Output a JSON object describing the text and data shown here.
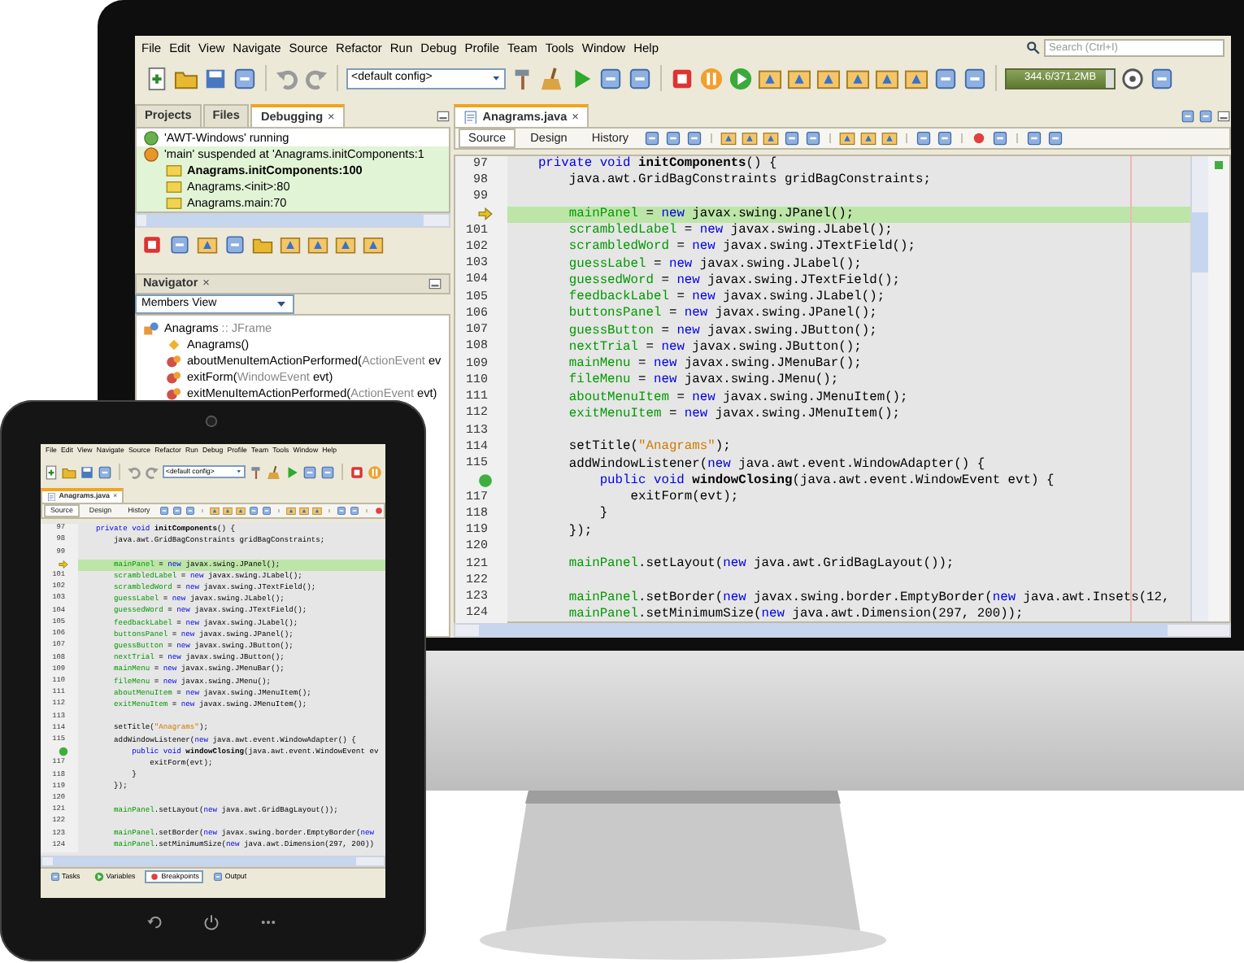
{
  "monitor": {
    "menu": [
      "File",
      "Edit",
      "View",
      "Navigate",
      "Source",
      "Refactor",
      "Run",
      "Debug",
      "Profile",
      "Team",
      "Tools",
      "Window",
      "Help"
    ],
    "search": {
      "placeholder": "Search (Ctrl+I)"
    },
    "config": "<default config>",
    "memory": {
      "reading": "344.6/371.2MB",
      "level": 0.93
    },
    "side_tabs": [
      {
        "label": "Projects",
        "selected": false
      },
      {
        "label": "Files",
        "selected": false
      },
      {
        "label": "Debugging",
        "selected": true,
        "close": "×"
      }
    ],
    "debug_tree": [
      {
        "kind": "running",
        "text": "'AWT-Windows' running"
      },
      {
        "kind": "suspended",
        "text": "'main' suspended at 'Anagrams.initComponents:1",
        "children": [
          {
            "kind": "frame",
            "text": "Anagrams.initComponents:100",
            "current": true
          },
          {
            "kind": "frame",
            "text": "Anagrams.<init>:80",
            "current": false
          },
          {
            "kind": "frame",
            "text": "Anagrams.main:70",
            "current": false
          }
        ]
      }
    ],
    "navigator": {
      "title": "Navigator",
      "close": "×",
      "view": "Members View",
      "tree": [
        {
          "kind": "class",
          "name": "Anagrams",
          "type": " :: JFrame",
          "children": [
            {
              "kind": "constructor",
              "name": "Anagrams()"
            },
            {
              "kind": "method",
              "name": "aboutMenuItemActionPerformed(",
              "type": "ActionEvent",
              "arg": " ev"
            },
            {
              "kind": "method",
              "name": "exitForm(",
              "type": "WindowEvent",
              "arg": " evt)"
            },
            {
              "kind": "method",
              "name": "exitMenuItemActionPerformed(",
              "type": "ActionEvent",
              "arg": " evt)"
            }
          ]
        }
      ]
    },
    "editor": {
      "tab": {
        "label": "Anagrams.java",
        "close": "×"
      },
      "views": [
        {
          "label": "Source",
          "selected": true
        },
        {
          "label": "Design",
          "selected": false
        },
        {
          "label": "History",
          "selected": false
        }
      ],
      "lines": [
        {
          "kind": "num",
          "num": "97",
          "current": false,
          "code": [
            {
              "kind": "keyword",
              "text": "    private void "
            },
            {
              "kind": "method",
              "text": "initComponents"
            },
            {
              "kind": "plain",
              "text": "() {"
            }
          ]
        },
        {
          "kind": "num",
          "num": "98",
          "current": false,
          "code": [
            {
              "kind": "plain",
              "text": "        java.awt.GridBagConstraints gridBagConstraints;"
            }
          ]
        },
        {
          "kind": "num",
          "num": "99",
          "current": false
        },
        {
          "kind": "arrow",
          "current": true,
          "code": [
            {
              "kind": "field",
              "text": "        mainPanel"
            },
            {
              "kind": "plain",
              "text": " = "
            },
            {
              "kind": "keyword",
              "text": "new"
            },
            {
              "kind": "plain",
              "text": " javax.swing.JPanel();"
            }
          ]
        },
        {
          "kind": "num",
          "num": "101",
          "current": false,
          "code": [
            {
              "kind": "field",
              "text": "        scrambledLabel"
            },
            {
              "kind": "plain",
              "text": " = "
            },
            {
              "kind": "keyword",
              "text": "new"
            },
            {
              "kind": "plain",
              "text": " javax.swing.JLabel();"
            }
          ]
        },
        {
          "kind": "num",
          "num": "102",
          "current": false,
          "code": [
            {
              "kind": "field",
              "text": "        scrambledWord"
            },
            {
              "kind": "plain",
              "text": " = "
            },
            {
              "kind": "keyword",
              "text": "new"
            },
            {
              "kind": "plain",
              "text": " javax.swing.JTextField();"
            }
          ]
        },
        {
          "kind": "num",
          "num": "103",
          "current": false,
          "code": [
            {
              "kind": "field",
              "text": "        guessLabel"
            },
            {
              "kind": "plain",
              "text": " = "
            },
            {
              "kind": "keyword",
              "text": "new"
            },
            {
              "kind": "plain",
              "text": " javax.swing.JLabel();"
            }
          ]
        },
        {
          "kind": "num",
          "num": "104",
          "current": false,
          "code": [
            {
              "kind": "field",
              "text": "        guessedWord"
            },
            {
              "kind": "plain",
              "text": " = "
            },
            {
              "kind": "keyword",
              "text": "new"
            },
            {
              "kind": "plain",
              "text": " javax.swing.JTextField();"
            }
          ]
        },
        {
          "kind": "num",
          "num": "105",
          "current": false,
          "code": [
            {
              "kind": "field",
              "text": "        feedbackLabel"
            },
            {
              "kind": "plain",
              "text": " = "
            },
            {
              "kind": "keyword",
              "text": "new"
            },
            {
              "kind": "plain",
              "text": " javax.swing.JLabel();"
            }
          ]
        },
        {
          "kind": "num",
          "num": "106",
          "current": false,
          "code": [
            {
              "kind": "field",
              "text": "        buttonsPanel"
            },
            {
              "kind": "plain",
              "text": " = "
            },
            {
              "kind": "keyword",
              "text": "new"
            },
            {
              "kind": "plain",
              "text": " javax.swing.JPanel();"
            }
          ]
        },
        {
          "kind": "num",
          "num": "107",
          "current": false,
          "code": [
            {
              "kind": "field",
              "text": "        guessButton"
            },
            {
              "kind": "plain",
              "text": " = "
            },
            {
              "kind": "keyword",
              "text": "new"
            },
            {
              "kind": "plain",
              "text": " javax.swing.JButton();"
            }
          ]
        },
        {
          "kind": "num",
          "num": "108",
          "current": false,
          "code": [
            {
              "kind": "field",
              "text": "        nextTrial"
            },
            {
              "kind": "plain",
              "text": " = "
            },
            {
              "kind": "keyword",
              "text": "new"
            },
            {
              "kind": "plain",
              "text": " javax.swing.JButton();"
            }
          ]
        },
        {
          "kind": "num",
          "num": "109",
          "current": false,
          "code": [
            {
              "kind": "field",
              "text": "        mainMenu"
            },
            {
              "kind": "plain",
              "text": " = "
            },
            {
              "kind": "keyword",
              "text": "new"
            },
            {
              "kind": "plain",
              "text": " javax.swing.JMenuBar();"
            }
          ]
        },
        {
          "kind": "num",
          "num": "110",
          "current": false,
          "code": [
            {
              "kind": "field",
              "text": "        fileMenu"
            },
            {
              "kind": "plain",
              "text": " = "
            },
            {
              "kind": "keyword",
              "text": "new"
            },
            {
              "kind": "plain",
              "text": " javax.swing.JMenu();"
            }
          ]
        },
        {
          "kind": "num",
          "num": "111",
          "current": false,
          "code": [
            {
              "kind": "field",
              "text": "        aboutMenuItem"
            },
            {
              "kind": "plain",
              "text": " = "
            },
            {
              "kind": "keyword",
              "text": "new"
            },
            {
              "kind": "plain",
              "text": " javax.swing.JMenuItem();"
            }
          ]
        },
        {
          "kind": "num",
          "num": "112",
          "current": false,
          "code": [
            {
              "kind": "field",
              "text": "        exitMenuItem"
            },
            {
              "kind": "plain",
              "text": " = "
            },
            {
              "kind": "keyword",
              "text": "new"
            },
            {
              "kind": "plain",
              "text": " javax.swing.JMenuItem();"
            }
          ]
        },
        {
          "kind": "num",
          "num": "113",
          "current": false
        },
        {
          "kind": "num",
          "num": "114",
          "current": false,
          "code": [
            {
              "kind": "plain",
              "text": "        setTitle("
            },
            {
              "kind": "string",
              "text": "\"Anagrams\""
            },
            {
              "kind": "plain",
              "text": ");"
            }
          ]
        },
        {
          "kind": "num",
          "num": "115",
          "current": false,
          "code": [
            {
              "kind": "plain",
              "text": "        addWindowListener("
            },
            {
              "kind": "keyword",
              "text": "new"
            },
            {
              "kind": "plain",
              "text": " java.awt.event.WindowAdapter() {"
            }
          ]
        },
        {
          "kind": "dot",
          "current": false,
          "code": [
            {
              "kind": "keyword",
              "text": "            public void "
            },
            {
              "kind": "method",
              "text": "windowClosing"
            },
            {
              "kind": "plain",
              "text": "(java.awt.event.WindowEvent evt) {"
            }
          ]
        },
        {
          "kind": "num",
          "num": "117",
          "current": false,
          "code": [
            {
              "kind": "plain",
              "text": "                exitForm(evt);"
            }
          ]
        },
        {
          "kind": "num",
          "num": "118",
          "current": false,
          "code": [
            {
              "kind": "plain",
              "text": "            }"
            }
          ]
        },
        {
          "kind": "num",
          "num": "119",
          "current": false,
          "code": [
            {
              "kind": "plain",
              "text": "        });"
            }
          ]
        },
        {
          "kind": "num",
          "num": "120",
          "current": false
        },
        {
          "kind": "num",
          "num": "121",
          "current": false,
          "code": [
            {
              "kind": "field",
              "text": "        mainPanel"
            },
            {
              "kind": "plain",
              "text": ".setLayout("
            },
            {
              "kind": "keyword",
              "text": "new"
            },
            {
              "kind": "plain",
              "text": " java.awt.GridBagLayout());"
            }
          ]
        },
        {
          "kind": "num",
          "num": "122",
          "current": false
        },
        {
          "kind": "num",
          "num": "123",
          "current": false,
          "code": [
            {
              "kind": "field",
              "text": "        mainPanel"
            },
            {
              "kind": "plain",
              "text": ".setBorder("
            },
            {
              "kind": "keyword",
              "text": "new"
            },
            {
              "kind": "plain",
              "text": " javax.swing.border.EmptyBorder("
            },
            {
              "kind": "keyword",
              "text": "new"
            },
            {
              "kind": "plain",
              "text": " java.awt.Insets(12,"
            }
          ]
        },
        {
          "kind": "num",
          "num": "124",
          "current": false,
          "code": [
            {
              "kind": "field",
              "text": "        mainPanel"
            },
            {
              "kind": "plain",
              "text": ".setMinimumSize("
            },
            {
              "kind": "keyword",
              "text": "new"
            },
            {
              "kind": "plain",
              "text": " java.awt.Dimension(297, 200));"
            }
          ]
        }
      ]
    }
  },
  "tablet": {
    "menu": [
      "File",
      "Edit",
      "View",
      "Navigate",
      "Source",
      "Refactor",
      "Run",
      "Debug",
      "Profile",
      "Team",
      "Tools",
      "Window",
      "Help"
    ],
    "config": "<default config>",
    "editor": {
      "tab": {
        "label": "Anagrams.java",
        "close": "×"
      },
      "views": [
        {
          "label": "Source",
          "selected": true
        },
        {
          "label": "Design",
          "selected": false
        },
        {
          "label": "History",
          "selected": false
        }
      ],
      "lines": [
        {
          "kind": "num",
          "num": "97",
          "current": false,
          "code": [
            {
              "kind": "keyword",
              "text": "    private void "
            },
            {
              "kind": "method",
              "text": "initComponents"
            },
            {
              "kind": "plain",
              "text": "() {"
            }
          ]
        },
        {
          "kind": "num",
          "num": "98",
          "current": false,
          "code": [
            {
              "kind": "plain",
              "text": "        java.awt.GridBagConstraints gridBagConstraints;"
            }
          ]
        },
        {
          "kind": "num",
          "num": "99",
          "current": false
        },
        {
          "kind": "arrow",
          "current": true,
          "code": [
            {
              "kind": "field",
              "text": "        mainPanel"
            },
            {
              "kind": "plain",
              "text": " = "
            },
            {
              "kind": "keyword",
              "text": "new"
            },
            {
              "kind": "plain",
              "text": " javax.swing.JPanel();"
            }
          ]
        },
        {
          "kind": "num",
          "num": "101",
          "current": false,
          "code": [
            {
              "kind": "field",
              "text": "        scrambledLabel"
            },
            {
              "kind": "plain",
              "text": " = "
            },
            {
              "kind": "keyword",
              "text": "new"
            },
            {
              "kind": "plain",
              "text": " javax.swing.JLabel();"
            }
          ]
        },
        {
          "kind": "num",
          "num": "102",
          "current": false,
          "code": [
            {
              "kind": "field",
              "text": "        scrambledWord"
            },
            {
              "kind": "plain",
              "text": " = "
            },
            {
              "kind": "keyword",
              "text": "new"
            },
            {
              "kind": "plain",
              "text": " javax.swing.JTextField();"
            }
          ]
        },
        {
          "kind": "num",
          "num": "103",
          "current": false,
          "code": [
            {
              "kind": "field",
              "text": "        guessLabel"
            },
            {
              "kind": "plain",
              "text": " = "
            },
            {
              "kind": "keyword",
              "text": "new"
            },
            {
              "kind": "plain",
              "text": " javax.swing.JLabel();"
            }
          ]
        },
        {
          "kind": "num",
          "num": "104",
          "current": false,
          "code": [
            {
              "kind": "field",
              "text": "        guessedWord"
            },
            {
              "kind": "plain",
              "text": " = "
            },
            {
              "kind": "keyword",
              "text": "new"
            },
            {
              "kind": "plain",
              "text": " javax.swing.JTextField();"
            }
          ]
        },
        {
          "kind": "num",
          "num": "105",
          "current": false,
          "code": [
            {
              "kind": "field",
              "text": "        feedbackLabel"
            },
            {
              "kind": "plain",
              "text": " = "
            },
            {
              "kind": "keyword",
              "text": "new"
            },
            {
              "kind": "plain",
              "text": " javax.swing.JLabel();"
            }
          ]
        },
        {
          "kind": "num",
          "num": "106",
          "current": false,
          "code": [
            {
              "kind": "field",
              "text": "        buttonsPanel"
            },
            {
              "kind": "plain",
              "text": " = "
            },
            {
              "kind": "keyword",
              "text": "new"
            },
            {
              "kind": "plain",
              "text": " javax.swing.JPanel();"
            }
          ]
        },
        {
          "kind": "num",
          "num": "107",
          "current": false,
          "code": [
            {
              "kind": "field",
              "text": "        guessButton"
            },
            {
              "kind": "plain",
              "text": " = "
            },
            {
              "kind": "keyword",
              "text": "new"
            },
            {
              "kind": "plain",
              "text": " javax.swing.JButton();"
            }
          ]
        },
        {
          "kind": "num",
          "num": "108",
          "current": false,
          "code": [
            {
              "kind": "field",
              "text": "        nextTrial"
            },
            {
              "kind": "plain",
              "text": " = "
            },
            {
              "kind": "keyword",
              "text": "new"
            },
            {
              "kind": "plain",
              "text": " javax.swing.JButton();"
            }
          ]
        },
        {
          "kind": "num",
          "num": "109",
          "current": false,
          "code": [
            {
              "kind": "field",
              "text": "        mainMenu"
            },
            {
              "kind": "plain",
              "text": " = "
            },
            {
              "kind": "keyword",
              "text": "new"
            },
            {
              "kind": "plain",
              "text": " javax.swing.JMenuBar();"
            }
          ]
        },
        {
          "kind": "num",
          "num": "110",
          "current": false,
          "code": [
            {
              "kind": "field",
              "text": "        fileMenu"
            },
            {
              "kind": "plain",
              "text": " = "
            },
            {
              "kind": "keyword",
              "text": "new"
            },
            {
              "kind": "plain",
              "text": " javax.swing.JMenu();"
            }
          ]
        },
        {
          "kind": "num",
          "num": "111",
          "current": false,
          "code": [
            {
              "kind": "field",
              "text": "        aboutMenuItem"
            },
            {
              "kind": "plain",
              "text": " = "
            },
            {
              "kind": "keyword",
              "text": "new"
            },
            {
              "kind": "plain",
              "text": " javax.swing.JMenuItem();"
            }
          ]
        },
        {
          "kind": "num",
          "num": "112",
          "current": false,
          "code": [
            {
              "kind": "field",
              "text": "        exitMenuItem"
            },
            {
              "kind": "plain",
              "text": " = "
            },
            {
              "kind": "keyword",
              "text": "new"
            },
            {
              "kind": "plain",
              "text": " javax.swing.JMenuItem();"
            }
          ]
        },
        {
          "kind": "num",
          "num": "113",
          "current": false
        },
        {
          "kind": "num",
          "num": "114",
          "current": false,
          "code": [
            {
              "kind": "plain",
              "text": "        setTitle("
            },
            {
              "kind": "string",
              "text": "\"Anagrams\""
            },
            {
              "kind": "plain",
              "text": ");"
            }
          ]
        },
        {
          "kind": "num",
          "num": "115",
          "current": false,
          "code": [
            {
              "kind": "plain",
              "text": "        addWindowListener("
            },
            {
              "kind": "keyword",
              "text": "new"
            },
            {
              "kind": "plain",
              "text": " java.awt.event.WindowAdapter() {"
            }
          ]
        },
        {
          "kind": "dot",
          "current": false,
          "code": [
            {
              "kind": "keyword",
              "text": "            public void "
            },
            {
              "kind": "method",
              "text": "windowClosing"
            },
            {
              "kind": "plain",
              "text": "(java.awt.event.WindowEvent ev"
            }
          ]
        },
        {
          "kind": "num",
          "num": "117",
          "current": false,
          "code": [
            {
              "kind": "plain",
              "text": "                exitForm(evt);"
            }
          ]
        },
        {
          "kind": "num",
          "num": "118",
          "current": false,
          "code": [
            {
              "kind": "plain",
              "text": "            }"
            }
          ]
        },
        {
          "kind": "num",
          "num": "119",
          "current": false,
          "code": [
            {
              "kind": "plain",
              "text": "        });"
            }
          ]
        },
        {
          "kind": "num",
          "num": "120",
          "current": false
        },
        {
          "kind": "num",
          "num": "121",
          "current": false,
          "code": [
            {
              "kind": "field",
              "text": "        mainPanel"
            },
            {
              "kind": "plain",
              "text": ".setLayout("
            },
            {
              "kind": "keyword",
              "text": "new"
            },
            {
              "kind": "plain",
              "text": " java.awt.GridBagLayout());"
            }
          ]
        },
        {
          "kind": "num",
          "num": "122",
          "current": false
        },
        {
          "kind": "num",
          "num": "123",
          "current": false,
          "code": [
            {
              "kind": "field",
              "text": "        mainPanel"
            },
            {
              "kind": "plain",
              "text": ".setBorder("
            },
            {
              "kind": "keyword",
              "text": "new"
            },
            {
              "kind": "plain",
              "text": " javax.swing.border.EmptyBorder("
            },
            {
              "kind": "keyword",
              "text": "new"
            }
          ]
        },
        {
          "kind": "num",
          "num": "124",
          "current": false,
          "code": [
            {
              "kind": "field",
              "text": "        mainPanel"
            },
            {
              "kind": "plain",
              "text": ".setMinimumSize("
            },
            {
              "kind": "keyword",
              "text": "new"
            },
            {
              "kind": "plain",
              "text": " java.awt.Dimension(297, 200))"
            }
          ]
        }
      ]
    },
    "bottom_tabs": [
      {
        "label": "Tasks",
        "selected": false
      },
      {
        "label": "Variables",
        "selected": false
      },
      {
        "label": "Breakpoints",
        "selected": true
      },
      {
        "label": "Output",
        "selected": false
      }
    ]
  }
}
